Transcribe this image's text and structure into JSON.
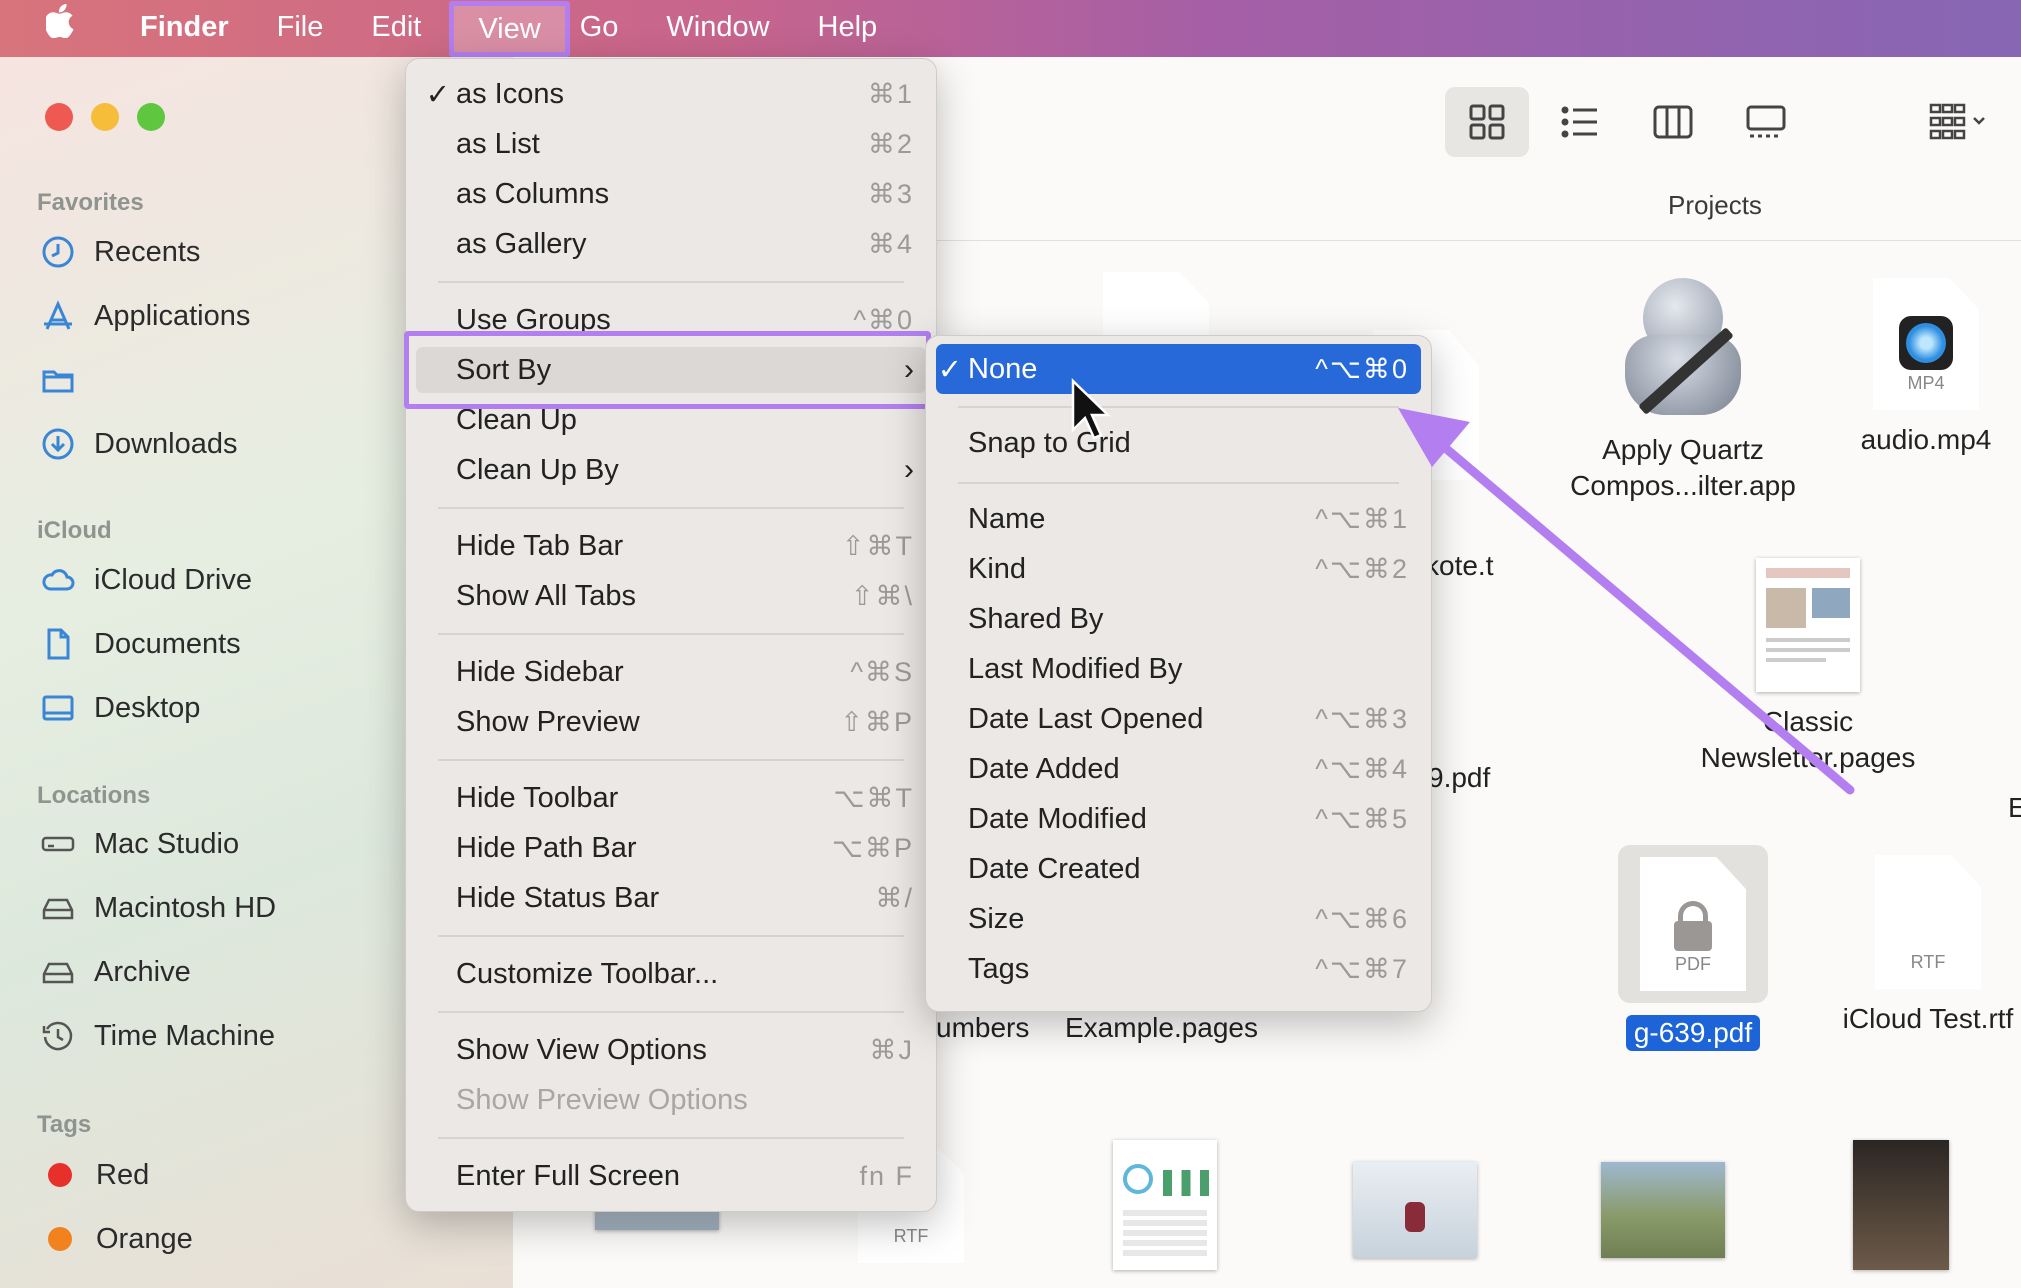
{
  "menubar": {
    "apple": "",
    "items": [
      "Finder",
      "File",
      "Edit",
      "View",
      "Go",
      "Window",
      "Help"
    ]
  },
  "sidebar": {
    "favorites_head": "Favorites",
    "favorites": [
      "Recents",
      "Applications",
      "",
      "Downloads"
    ],
    "icloud_head": "iCloud",
    "icloud": [
      "iCloud Drive",
      "Documents",
      "Desktop"
    ],
    "locations_head": "Locations",
    "locations": [
      "Mac Studio",
      "Macintosh HD",
      "Archive",
      "Time Machine"
    ],
    "tags_head": "Tags",
    "tags": [
      {
        "label": "Red",
        "color": "#e8302b"
      },
      {
        "label": "Orange",
        "color": "#f2821e"
      }
    ]
  },
  "toolbar": {
    "title": "Projects"
  },
  "files": {
    "apply_quartz": "Apply Quartz\nCompos...ilter.app",
    "audio": "audio.mp4",
    "audio_tag": "MP4",
    "kote": "kote.t",
    "pdf9": "9.pdf",
    "classic": "Classic\nNewsletter.pages",
    "e_partial": "E",
    "locked_pdf": "g-639.pdf",
    "locked_pdf_tag": "PDF",
    "icloud_test": "iCloud Test.rtf",
    "icloud_test_tag": "RTF",
    "numbers": "umbers",
    "example": "Example.pages",
    "rtf_bottom_tag": "RTF"
  },
  "view_menu": [
    {
      "check": "✓",
      "label": "as Icons",
      "shortcut": "⌘1"
    },
    {
      "check": "",
      "label": "as List",
      "shortcut": "⌘2"
    },
    {
      "check": "",
      "label": "as Columns",
      "shortcut": "⌘3"
    },
    {
      "check": "",
      "label": "as Gallery",
      "shortcut": "⌘4"
    },
    {
      "check": "",
      "label": "Use Groups",
      "shortcut": "^⌘0"
    },
    {
      "check": "",
      "label": "Sort By",
      "shortcut": ""
    },
    {
      "check": "",
      "label": "Clean Up",
      "shortcut": ""
    },
    {
      "check": "",
      "label": "Clean Up By",
      "shortcut": ""
    },
    {
      "check": "",
      "label": "Hide Tab Bar",
      "shortcut": "⇧⌘T"
    },
    {
      "check": "",
      "label": "Show All Tabs",
      "shortcut": "⇧⌘\\"
    },
    {
      "check": "",
      "label": "Hide Sidebar",
      "shortcut": "^⌘S"
    },
    {
      "check": "",
      "label": "Show Preview",
      "shortcut": "⇧⌘P"
    },
    {
      "check": "",
      "label": "Hide Toolbar",
      "shortcut": "⌥⌘T"
    },
    {
      "check": "",
      "label": "Hide Path Bar",
      "shortcut": "⌥⌘P"
    },
    {
      "check": "",
      "label": "Hide Status Bar",
      "shortcut": "⌘/"
    },
    {
      "check": "",
      "label": "Customize Toolbar...",
      "shortcut": ""
    },
    {
      "check": "",
      "label": "Show View Options",
      "shortcut": "⌘J"
    },
    {
      "check": "",
      "label": "Show Preview Options",
      "shortcut": ""
    },
    {
      "check": "",
      "label": "Enter Full Screen",
      "shortcut": "fn F"
    }
  ],
  "sort_menu": [
    {
      "check": "✓",
      "label": "None",
      "shortcut": "^⌥⌘0"
    },
    {
      "check": "",
      "label": "Snap to Grid",
      "shortcut": ""
    },
    {
      "check": "",
      "label": "Name",
      "shortcut": "^⌥⌘1"
    },
    {
      "check": "",
      "label": "Kind",
      "shortcut": "^⌥⌘2"
    },
    {
      "check": "",
      "label": "Shared By",
      "shortcut": ""
    },
    {
      "check": "",
      "label": "Last Modified By",
      "shortcut": ""
    },
    {
      "check": "",
      "label": "Date Last Opened",
      "shortcut": "^⌥⌘3"
    },
    {
      "check": "",
      "label": "Date Added",
      "shortcut": "^⌥⌘4"
    },
    {
      "check": "",
      "label": "Date Modified",
      "shortcut": "^⌥⌘5"
    },
    {
      "check": "",
      "label": "Date Created",
      "shortcut": ""
    },
    {
      "check": "",
      "label": "Size",
      "shortcut": "^⌥⌘6"
    },
    {
      "check": "",
      "label": "Tags",
      "shortcut": "^⌥⌘7"
    }
  ],
  "colors": {
    "highlight": "#b37ff0",
    "selection": "#2769d9",
    "accent": "#3a86d6"
  }
}
